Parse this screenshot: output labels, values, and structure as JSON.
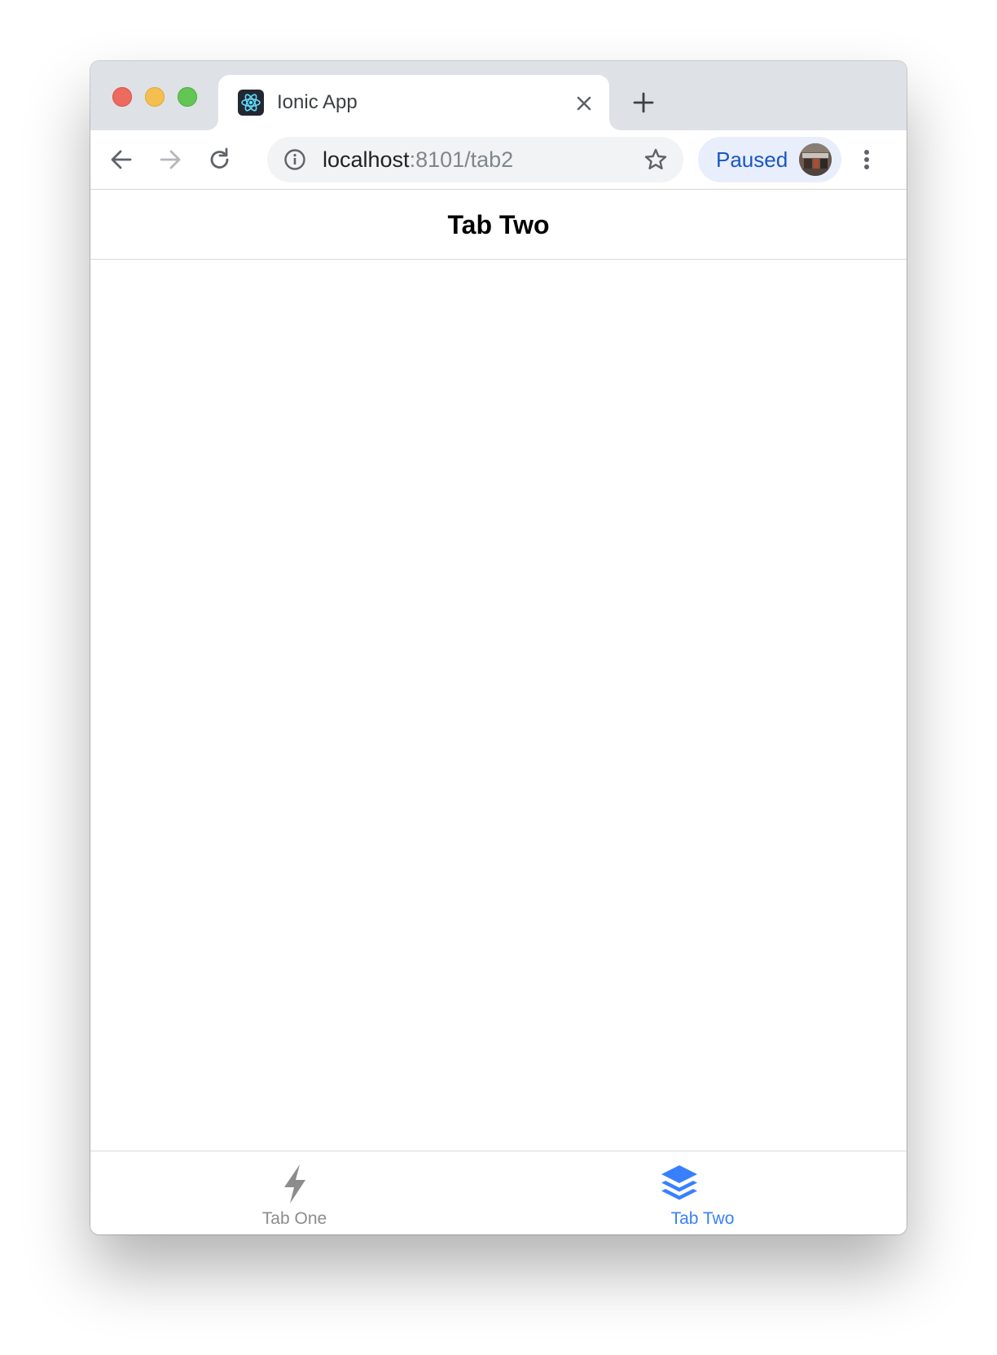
{
  "browser": {
    "tab": {
      "title": "Ionic App",
      "favicon_icon": "react-atom-icon",
      "close_icon": "close-icon"
    },
    "new_tab_icon": "plus-icon",
    "toolbar": {
      "back_icon": "arrow-left-icon",
      "forward_icon": "arrow-right-icon",
      "reload_icon": "reload-icon",
      "url_host": "localhost",
      "url_path": ":8101/tab2",
      "site_info_icon": "info-icon",
      "bookmark_icon": "star-icon",
      "profile_label": "Paused",
      "menu_icon": "more-vertical-icon"
    },
    "colors": {
      "tabstrip": "#dee1e6",
      "profile_chip": "#e8eefb",
      "profile_text": "#1a56c4"
    }
  },
  "app": {
    "header_title": "Tab Two",
    "tabs": [
      {
        "label": "Tab One",
        "icon": "flash-icon",
        "selected": false,
        "color": "#8c8c8c"
      },
      {
        "label": "Tab Two",
        "icon": "layers-icon",
        "selected": true,
        "color": "#3880ff"
      }
    ]
  }
}
